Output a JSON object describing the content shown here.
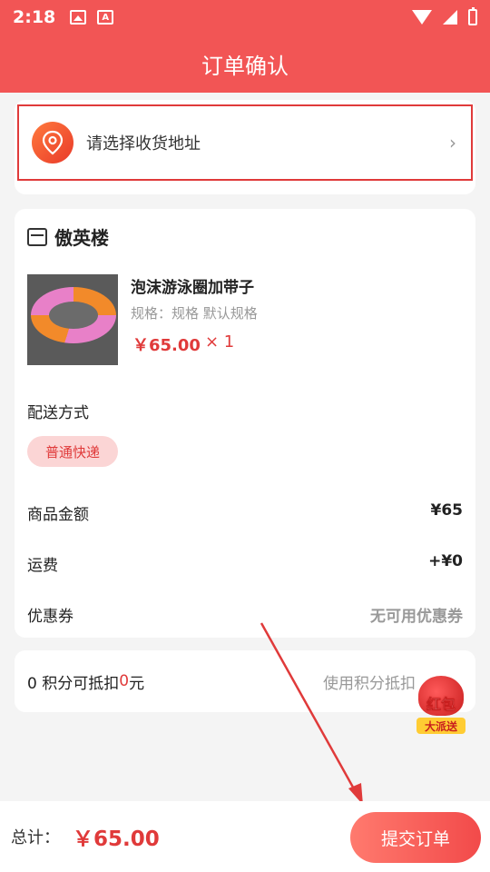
{
  "status_bar": {
    "time": "2:18",
    "notif_a": "A"
  },
  "header": {
    "title": "订单确认"
  },
  "address": {
    "placeholder": "请选择收货地址",
    "chevron": "›"
  },
  "shop": {
    "name": "傲英楼",
    "product": {
      "title": "泡沫游泳圈加带子",
      "spec": "规格：规格 默认规格",
      "price": "￥65.00",
      "quantity": "× 1"
    },
    "delivery": {
      "label": "配送方式",
      "option": "普通快递"
    },
    "summary": [
      {
        "label": "商品金额",
        "value": "¥65"
      },
      {
        "label": "运费",
        "value": "+¥0"
      },
      {
        "label": "优惠券",
        "value": "无可用优惠券"
      }
    ]
  },
  "points": {
    "prefix": "0 积分可抵扣",
    "amount": "0",
    "suffix": "元",
    "action": "使用积分抵扣"
  },
  "red_packet": {
    "line1": "红包",
    "line2": "大派送"
  },
  "footer": {
    "total_label": "总计：",
    "total_value": "￥65.00",
    "submit_label": "提交订单"
  },
  "colors": {
    "primary": "#f25555",
    "accent_red": "#e03a3a",
    "chip_bg": "#fbd5d5"
  }
}
